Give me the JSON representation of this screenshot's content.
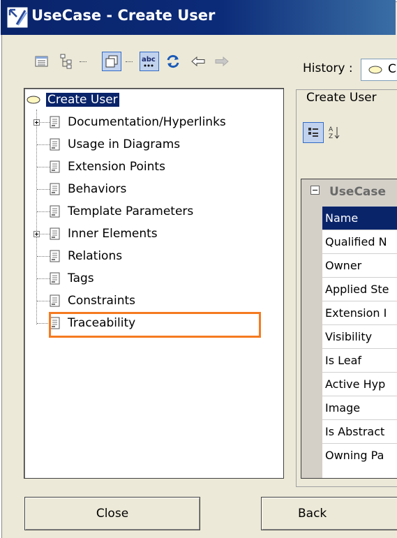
{
  "window": {
    "title": "UseCase - Create User"
  },
  "toolbar": {
    "history_label": "History :",
    "buttons": [
      "table-view-icon",
      "tree-view-icon",
      "quick-view-icon",
      "spellcheck-icon",
      "refresh-icon",
      "back-arrow-icon",
      "forward-arrow-icon"
    ]
  },
  "tree": {
    "root": "Create User",
    "items": [
      {
        "label": "Documentation/Hyperlinks",
        "expandable": true
      },
      {
        "label": "Usage in Diagrams",
        "expandable": false
      },
      {
        "label": "Extension Points",
        "expandable": false
      },
      {
        "label": "Behaviors",
        "expandable": false
      },
      {
        "label": "Template Parameters",
        "expandable": false
      },
      {
        "label": "Inner Elements",
        "expandable": true
      },
      {
        "label": "Relations",
        "expandable": false
      },
      {
        "label": "Tags",
        "expandable": false
      },
      {
        "label": "Constraints",
        "expandable": false
      },
      {
        "label": "Traceability",
        "expandable": false,
        "highlighted": true
      }
    ]
  },
  "properties": {
    "group_title": "Create User",
    "section_title": "UseCase",
    "rows": [
      "Name",
      "Qualified N",
      "Owner",
      "Applied Ste",
      "Extension I",
      "Visibility",
      "Is Leaf",
      "Active Hyp",
      "Image",
      "Is Abstract",
      "Owning Pa"
    ],
    "selected_row": "Name"
  },
  "footer": {
    "close_label": "Close",
    "back_label": "Back"
  },
  "colors": {
    "selection": "#0a246a",
    "highlight": "#f57a20",
    "title_bar": "#0a246a"
  }
}
